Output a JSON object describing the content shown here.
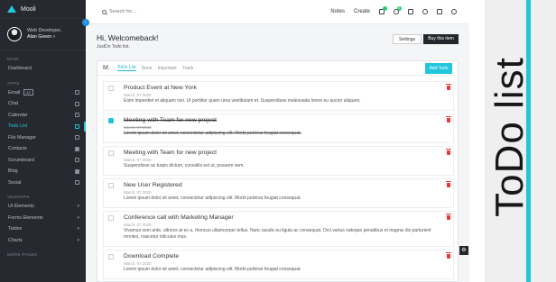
{
  "app": {
    "brand": "Mooli"
  },
  "profile": {
    "role": "Web Developer,",
    "name": "Alan Green"
  },
  "sidebar": {
    "sections": [
      {
        "title": "MAIN",
        "items": [
          {
            "label": "Dashboard"
          }
        ]
      },
      {
        "title": "APPS",
        "items": [
          {
            "label": "Email",
            "badge": "12"
          },
          {
            "label": "Chat"
          },
          {
            "label": "Calendar"
          },
          {
            "label": "Todo List",
            "active": true
          },
          {
            "label": "File Manager"
          },
          {
            "label": "Contacts"
          },
          {
            "label": "Scrumboard"
          },
          {
            "label": "Blog"
          },
          {
            "label": "Social"
          }
        ]
      },
      {
        "title": "VENDORS",
        "items": [
          {
            "label": "UI Elements"
          },
          {
            "label": "Forms Elements"
          },
          {
            "label": "Tables"
          },
          {
            "label": "Charts"
          }
        ]
      },
      {
        "title": "MORE PAGES",
        "items": []
      }
    ]
  },
  "topbar": {
    "search_placeholder": "Search for…",
    "links": [
      "Notes",
      "Create"
    ],
    "notification_count": "4"
  },
  "header": {
    "greeting": "Hi, Welcomeback!",
    "subtitle": "JustDo Todo list.",
    "settings_label": "Settings",
    "buy_label": "Buy this item"
  },
  "panel": {
    "initial": "M.",
    "tabs": [
      "ToDo List",
      "Done",
      "Important",
      "Trash"
    ],
    "add_label": "Add Todo"
  },
  "todos": [
    {
      "title": "Product Event at New York",
      "date": "March, 07 2020",
      "desc": "Enim imperdiet et aliquam nisi. Ut porttitor quam urna vestibulum et. Suspendisse malesuada lorem eu auctor aliquam.",
      "done": false
    },
    {
      "title": "Meeting with Team for new project",
      "date": "March, 07 2020",
      "desc": "Lorem ipsum dolor sit amet, consectetur adipiscing elit. Morbi pulvinar feugiat consequat.",
      "done": true
    },
    {
      "title": "Meeting with Team for new project",
      "date": "March, 07 2020",
      "desc": "Suspendisse ac turpis dictum, convallis est ut, posuere sem.",
      "done": false
    },
    {
      "title": "New User Registered",
      "date": "March, 07 2020",
      "desc": "Lorem ipsum dolor sit amet, consectetur adipiscing elit. Morbi pulvinar feugiat consequat.",
      "done": false
    },
    {
      "title": "Conference call with Marketing Manager",
      "date": "March, 07 2020",
      "desc": "Vivamus sem ante, ultrices at ex a, rhoncus ullamcorper tellus. Nunc iaculis eu ligula ac consequat. Orci varius natoque penatibus et magnis dis parturient montes, nascetur ridiculus mus.",
      "done": false
    },
    {
      "title": "Download Complete",
      "date": "March, 07 2020",
      "desc": "Lorem ipsum dolor sit amet, consectetur adipiscing elit. Morbi pulvinar feugiat consequat.",
      "done": false
    }
  ],
  "banner": {
    "text": "ToDo list"
  },
  "colors": {
    "accent": "#21c6dc",
    "sidebar": "#262a30",
    "danger": "#e23a3a"
  }
}
